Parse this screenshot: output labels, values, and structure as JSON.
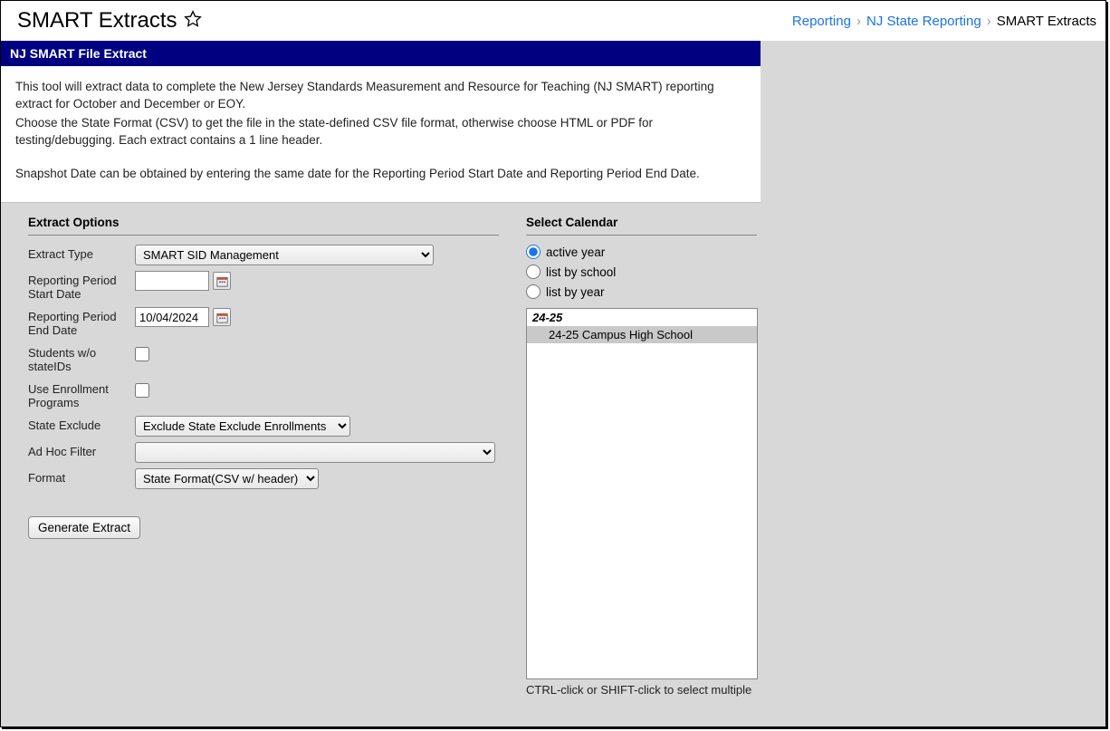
{
  "header": {
    "title": "SMART Extracts",
    "breadcrumb": {
      "items": [
        "Reporting",
        "NJ State Reporting"
      ],
      "current": "SMART Extracts"
    }
  },
  "panel": {
    "title": "NJ SMART File Extract",
    "intro": {
      "p1": "This tool will extract data to complete the New Jersey Standards Measurement and Resource for Teaching (NJ SMART) reporting extract for October and December or EOY.",
      "p2": "Choose the State Format (CSV) to get the file in the state-defined CSV file format, otherwise choose HTML or PDF for testing/debugging. Each extract contains a 1 line header.",
      "p3": "Snapshot Date can be obtained by entering the same date for the Reporting Period Start Date and Reporting Period End Date."
    }
  },
  "options": {
    "section_title": "Extract Options",
    "extract_type": {
      "label": "Extract Type",
      "value": "SMART SID Management"
    },
    "start_date": {
      "label": "Reporting Period Start Date",
      "value": ""
    },
    "end_date": {
      "label": "Reporting Period End Date",
      "value": "10/04/2024"
    },
    "students_wo": {
      "label": "Students w/o stateIDs"
    },
    "use_enroll": {
      "label": "Use Enrollment Programs"
    },
    "state_exclude": {
      "label": "State Exclude",
      "value": "Exclude State Exclude Enrollments"
    },
    "adhoc": {
      "label": "Ad Hoc Filter",
      "value": ""
    },
    "format": {
      "label": "Format",
      "value": "State Format(CSV w/ header)"
    },
    "generate": "Generate Extract"
  },
  "calendar": {
    "section_title": "Select Calendar",
    "radios": {
      "active": "active year",
      "school": "list by school",
      "year": "list by year"
    },
    "group": "24-25",
    "item": "24-25 Campus High School",
    "hint": "CTRL-click or SHIFT-click to select multiple"
  }
}
